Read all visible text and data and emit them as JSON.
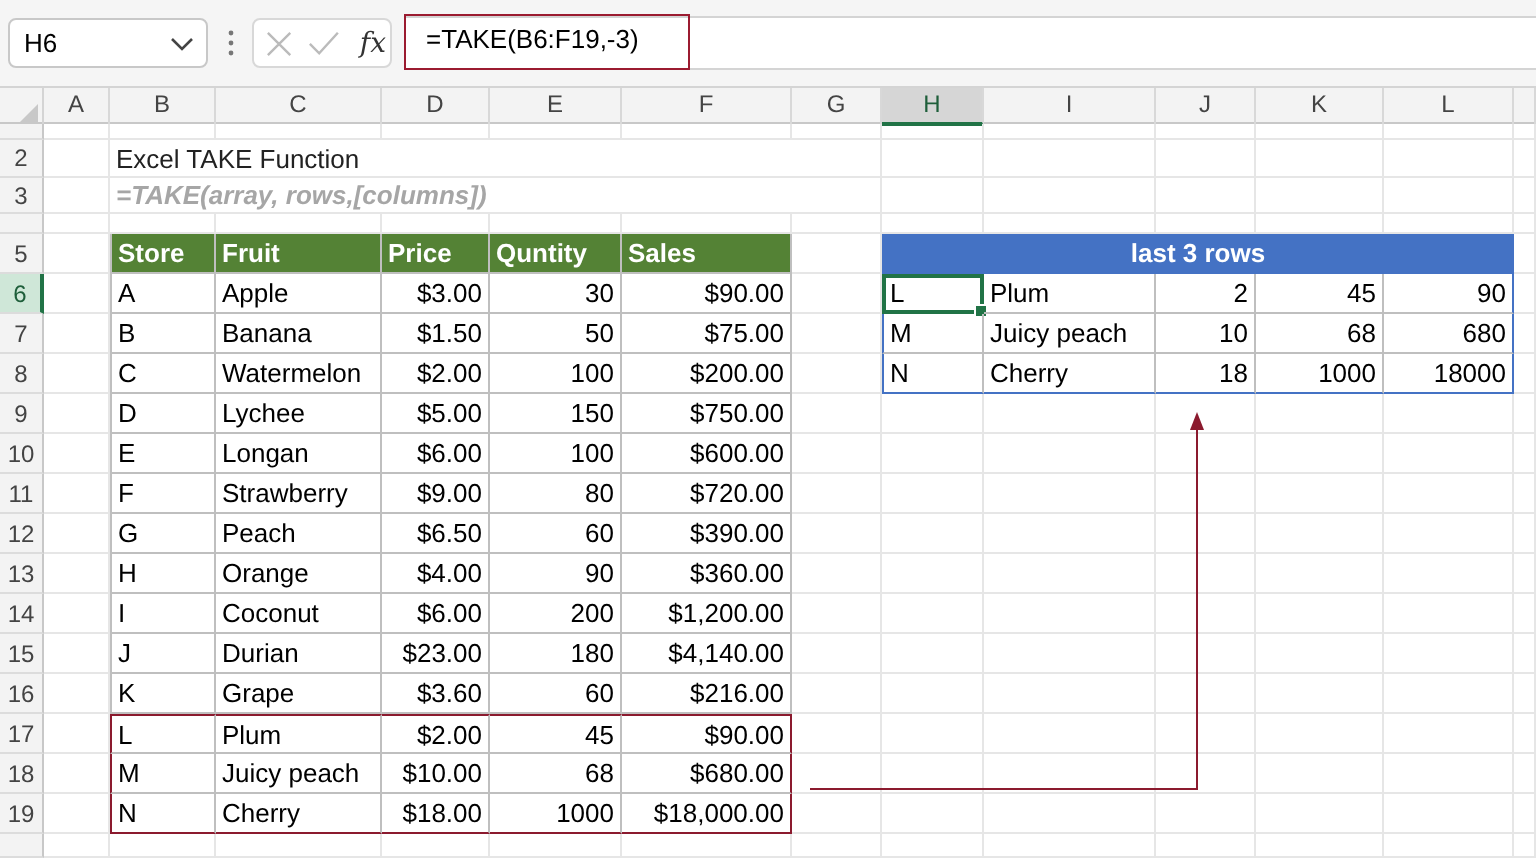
{
  "name_box": {
    "value": "H6"
  },
  "formula_bar": {
    "function_label": "fx",
    "value": "=TAKE(B6:F19,-3)"
  },
  "columns": [
    {
      "label": "A",
      "selected": false
    },
    {
      "label": "B",
      "selected": false
    },
    {
      "label": "C",
      "selected": false
    },
    {
      "label": "D",
      "selected": false
    },
    {
      "label": "E",
      "selected": false
    },
    {
      "label": "F",
      "selected": false
    },
    {
      "label": "G",
      "selected": false
    },
    {
      "label": "H",
      "selected": true
    },
    {
      "label": "I",
      "selected": false
    },
    {
      "label": "J",
      "selected": false
    },
    {
      "label": "K",
      "selected": false
    },
    {
      "label": "L",
      "selected": false
    }
  ],
  "row_headers": [
    {
      "label": "2",
      "selected": false
    },
    {
      "label": "3",
      "selected": false
    },
    {
      "label": "5",
      "selected": false
    },
    {
      "label": "6",
      "selected": true
    },
    {
      "label": "7",
      "selected": false
    },
    {
      "label": "8",
      "selected": false
    },
    {
      "label": "9",
      "selected": false
    },
    {
      "label": "10",
      "selected": false
    },
    {
      "label": "11",
      "selected": false
    },
    {
      "label": "12",
      "selected": false
    },
    {
      "label": "13",
      "selected": false
    },
    {
      "label": "14",
      "selected": false
    },
    {
      "label": "15",
      "selected": false
    },
    {
      "label": "16",
      "selected": false
    },
    {
      "label": "17",
      "selected": false
    },
    {
      "label": "18",
      "selected": false
    },
    {
      "label": "19",
      "selected": false
    }
  ],
  "title": "Excel TAKE Function",
  "syntax": "=TAKE(array, rows,[columns])",
  "source_table": {
    "columns": [
      "Store",
      "Fruit",
      "Price",
      "Quntity",
      "Sales"
    ],
    "rows": [
      {
        "cells": [
          "A",
          "Apple",
          "$3.00",
          "30",
          "$90.00"
        ],
        "highlighted": false
      },
      {
        "cells": [
          "B",
          "Banana",
          "$1.50",
          "50",
          "$75.00"
        ],
        "highlighted": false
      },
      {
        "cells": [
          "C",
          "Watermelon",
          "$2.00",
          "100",
          "$200.00"
        ],
        "highlighted": false
      },
      {
        "cells": [
          "D",
          "Lychee",
          "$5.00",
          "150",
          "$750.00"
        ],
        "highlighted": false
      },
      {
        "cells": [
          "E",
          "Longan",
          "$6.00",
          "100",
          "$600.00"
        ],
        "highlighted": false
      },
      {
        "cells": [
          "F",
          "Strawberry",
          "$9.00",
          "80",
          "$720.00"
        ],
        "highlighted": false
      },
      {
        "cells": [
          "G",
          "Peach",
          "$6.50",
          "60",
          "$390.00"
        ],
        "highlighted": false
      },
      {
        "cells": [
          "H",
          "Orange",
          "$4.00",
          "90",
          "$360.00"
        ],
        "highlighted": false
      },
      {
        "cells": [
          "I",
          "Coconut",
          "$6.00",
          "200",
          "$1,200.00"
        ],
        "highlighted": false
      },
      {
        "cells": [
          "J",
          "Durian",
          "$23.00",
          "180",
          "$4,140.00"
        ],
        "highlighted": false
      },
      {
        "cells": [
          "K",
          "Grape",
          "$3.60",
          "60",
          "$216.00"
        ],
        "highlighted": false
      },
      {
        "cells": [
          "L",
          "Plum",
          "$2.00",
          "45",
          "$90.00"
        ],
        "highlighted": true
      },
      {
        "cells": [
          "M",
          "Juicy peach",
          "$10.00",
          "68",
          "$680.00"
        ],
        "highlighted": true
      },
      {
        "cells": [
          "N",
          "Cherry",
          "$18.00",
          "1000",
          "$18,000.00"
        ],
        "highlighted": true
      }
    ]
  },
  "result_table": {
    "title": "last 3 rows",
    "rows": [
      {
        "cells": [
          {
            "text": "L",
            "selected": true
          },
          {
            "text": "Plum",
            "selected": false
          },
          {
            "text": "2",
            "selected": false
          },
          {
            "text": "45",
            "selected": false
          },
          {
            "text": "90",
            "selected": false
          }
        ]
      },
      {
        "cells": [
          {
            "text": "M",
            "selected": false
          },
          {
            "text": "Juicy peach",
            "selected": false
          },
          {
            "text": "10",
            "selected": false
          },
          {
            "text": "68",
            "selected": false
          },
          {
            "text": "680",
            "selected": false
          }
        ]
      },
      {
        "cells": [
          {
            "text": "N",
            "selected": false
          },
          {
            "text": "Cherry",
            "selected": false
          },
          {
            "text": "18",
            "selected": false
          },
          {
            "text": "1000",
            "selected": false
          },
          {
            "text": "18000",
            "selected": false
          }
        ]
      }
    ]
  }
}
